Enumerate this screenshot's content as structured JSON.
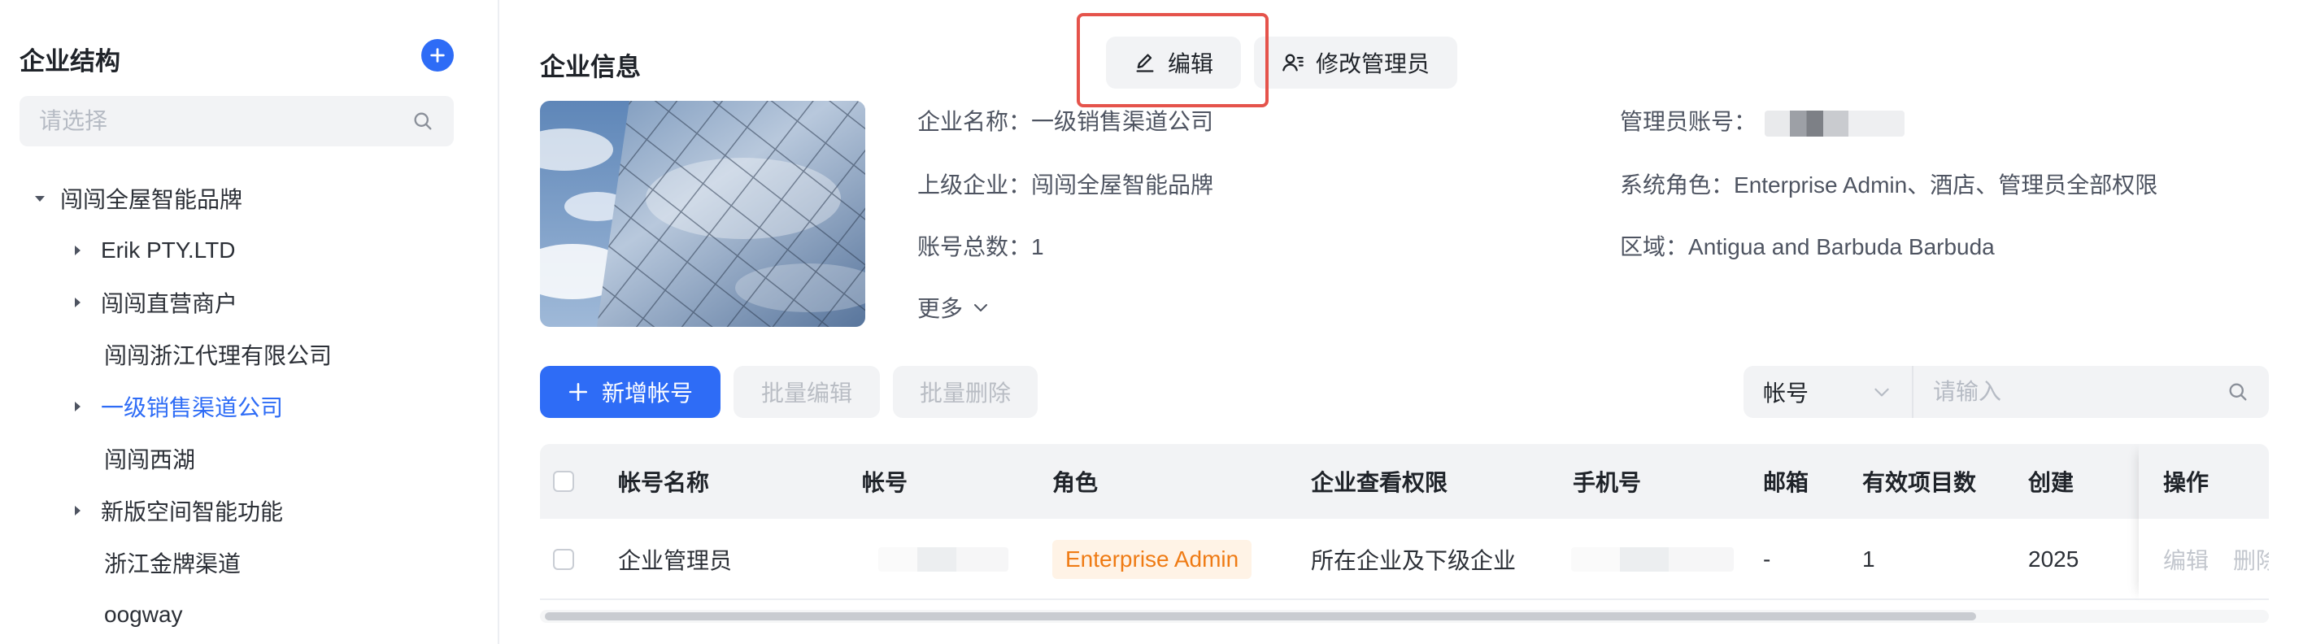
{
  "sidebar": {
    "title": "企业结构",
    "search_placeholder": "请选择",
    "tree": [
      {
        "label": "闯闯全屋智能品牌",
        "expanded": true,
        "has_children": true,
        "level": 0
      },
      {
        "label": "Erik PTY.LTD",
        "expanded": false,
        "has_children": true,
        "level": 1
      },
      {
        "label": "闯闯直营商户",
        "expanded": false,
        "has_children": true,
        "level": 1
      },
      {
        "label": "闯闯浙江代理有限公司",
        "expanded": false,
        "has_children": false,
        "level": 1
      },
      {
        "label": "一级销售渠道公司",
        "expanded": false,
        "has_children": true,
        "level": 1,
        "active": true
      },
      {
        "label": "闯闯西湖",
        "expanded": false,
        "has_children": false,
        "level": 1
      },
      {
        "label": "新版空间智能功能",
        "expanded": false,
        "has_children": true,
        "level": 1
      },
      {
        "label": "浙江金牌渠道",
        "expanded": false,
        "has_children": false,
        "level": 1
      },
      {
        "label": "oogway",
        "expanded": false,
        "has_children": false,
        "level": 1
      }
    ]
  },
  "main": {
    "title": "企业信息",
    "edit_label": "编辑",
    "change_admin_label": "修改管理员",
    "info": {
      "company_name_key": "企业名称：",
      "company_name": "一级销售渠道公司",
      "parent_key": "上级企业：",
      "parent": "闯闯全屋智能品牌",
      "accounts_key": "账号总数：",
      "accounts": "1",
      "admin_account_key": "管理员账号：",
      "system_role_key": "系统角色：",
      "system_role": "Enterprise Admin、酒店、管理员全部权限",
      "region_key": "区域：",
      "region": "Antigua and Barbuda Barbuda",
      "more_label": "更多"
    },
    "toolbar": {
      "add_label": "新增帐号",
      "bulk_edit_label": "批量编辑",
      "bulk_delete_label": "批量删除",
      "filter_field": "帐号",
      "search_placeholder": "请输入"
    },
    "table": {
      "columns": [
        "帐号名称",
        "帐号",
        "角色",
        "企业查看权限",
        "手机号",
        "邮箱",
        "有效项目数",
        "创建",
        "操作"
      ],
      "rows": [
        {
          "name": "企业管理员",
          "role": "Enterprise Admin",
          "permission": "所在企业及下级企业",
          "email": "-",
          "valid_projects": "1",
          "created": "2025",
          "actions": [
            "编辑",
            "删除"
          ]
        }
      ]
    }
  },
  "colors": {
    "accent": "#2e6cf6",
    "highlight_box": "#e5534b",
    "role_tag_text": "#ef7b14",
    "role_tag_bg": "#fff3e6"
  }
}
